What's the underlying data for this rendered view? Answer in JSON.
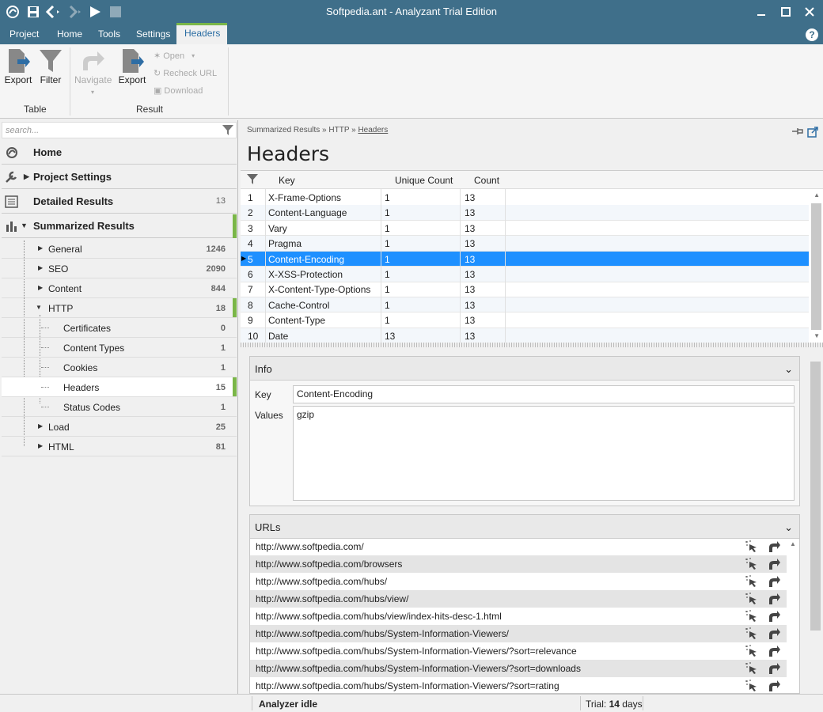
{
  "window": {
    "title": "Softpedia.ant - Analyzant Trial Edition"
  },
  "menu": {
    "tabs": [
      "Project",
      "Home",
      "Tools",
      "Settings",
      "Headers"
    ],
    "help": "?"
  },
  "ribbon": {
    "export1": "Export",
    "filter": "Filter",
    "navigate": "Navigate",
    "export2": "Export",
    "open": "Open",
    "recheck": "Recheck URL",
    "download": "Download",
    "group_table": "Table",
    "group_result": "Result"
  },
  "sidebar": {
    "search_placeholder": "search...",
    "home": "Home",
    "project_settings": "Project Settings",
    "detailed_results": {
      "label": "Detailed Results",
      "count": "13"
    },
    "summarized_results": "Summarized Results",
    "groups": [
      {
        "label": "General",
        "count": "1246"
      },
      {
        "label": "SEO",
        "count": "2090"
      },
      {
        "label": "Content",
        "count": "844"
      },
      {
        "label": "HTTP",
        "count": "18"
      }
    ],
    "http_children": [
      {
        "label": "Certificates",
        "count": "0"
      },
      {
        "label": "Content Types",
        "count": "1"
      },
      {
        "label": "Cookies",
        "count": "1"
      },
      {
        "label": "Headers",
        "count": "15"
      },
      {
        "label": "Status Codes",
        "count": "1"
      }
    ],
    "tail": [
      {
        "label": "Load",
        "count": "25"
      },
      {
        "label": "HTML",
        "count": "81"
      }
    ]
  },
  "breadcrumb": {
    "part1": "Summarized Results",
    "sep": "»",
    "part2": "HTTP",
    "part3": "Headers"
  },
  "page_title": "Headers",
  "table": {
    "columns": [
      "Key",
      "Unique Count",
      "Count"
    ],
    "rows": [
      {
        "n": "1",
        "key": "X-Frame-Options",
        "uc": "1",
        "ct": "13"
      },
      {
        "n": "2",
        "key": "Content-Language",
        "uc": "1",
        "ct": "13"
      },
      {
        "n": "3",
        "key": "Vary",
        "uc": "1",
        "ct": "13"
      },
      {
        "n": "4",
        "key": "Pragma",
        "uc": "1",
        "ct": "13"
      },
      {
        "n": "5",
        "key": "Content-Encoding",
        "uc": "1",
        "ct": "13"
      },
      {
        "n": "6",
        "key": "X-XSS-Protection",
        "uc": "1",
        "ct": "13"
      },
      {
        "n": "7",
        "key": "X-Content-Type-Options",
        "uc": "1",
        "ct": "13"
      },
      {
        "n": "8",
        "key": "Cache-Control",
        "uc": "1",
        "ct": "13"
      },
      {
        "n": "9",
        "key": "Content-Type",
        "uc": "1",
        "ct": "13"
      },
      {
        "n": "10",
        "key": "Date",
        "uc": "13",
        "ct": "13"
      }
    ]
  },
  "info": {
    "title": "Info",
    "key_label": "Key",
    "key_value": "Content-Encoding",
    "values_label": "Values",
    "values_value": "gzip"
  },
  "urls": {
    "title": "URLs",
    "items": [
      "http://www.softpedia.com/",
      "http://www.softpedia.com/browsers",
      "http://www.softpedia.com/hubs/",
      "http://www.softpedia.com/hubs/view/",
      "http://www.softpedia.com/hubs/view/index-hits-desc-1.html",
      "http://www.softpedia.com/hubs/System-Information-Viewers/",
      "http://www.softpedia.com/hubs/System-Information-Viewers/?sort=relevance",
      "http://www.softpedia.com/hubs/System-Information-Viewers/?sort=downloads",
      "http://www.softpedia.com/hubs/System-Information-Viewers/?sort=rating"
    ]
  },
  "status": {
    "analyzer": "Analyzer idle",
    "trial_prefix": "Trial:",
    "trial_days": "14",
    "trial_suffix": "days"
  },
  "colors": {
    "titlebar": "#3f6f8a",
    "accent_green": "#7ab648",
    "selection": "#1e90ff"
  }
}
